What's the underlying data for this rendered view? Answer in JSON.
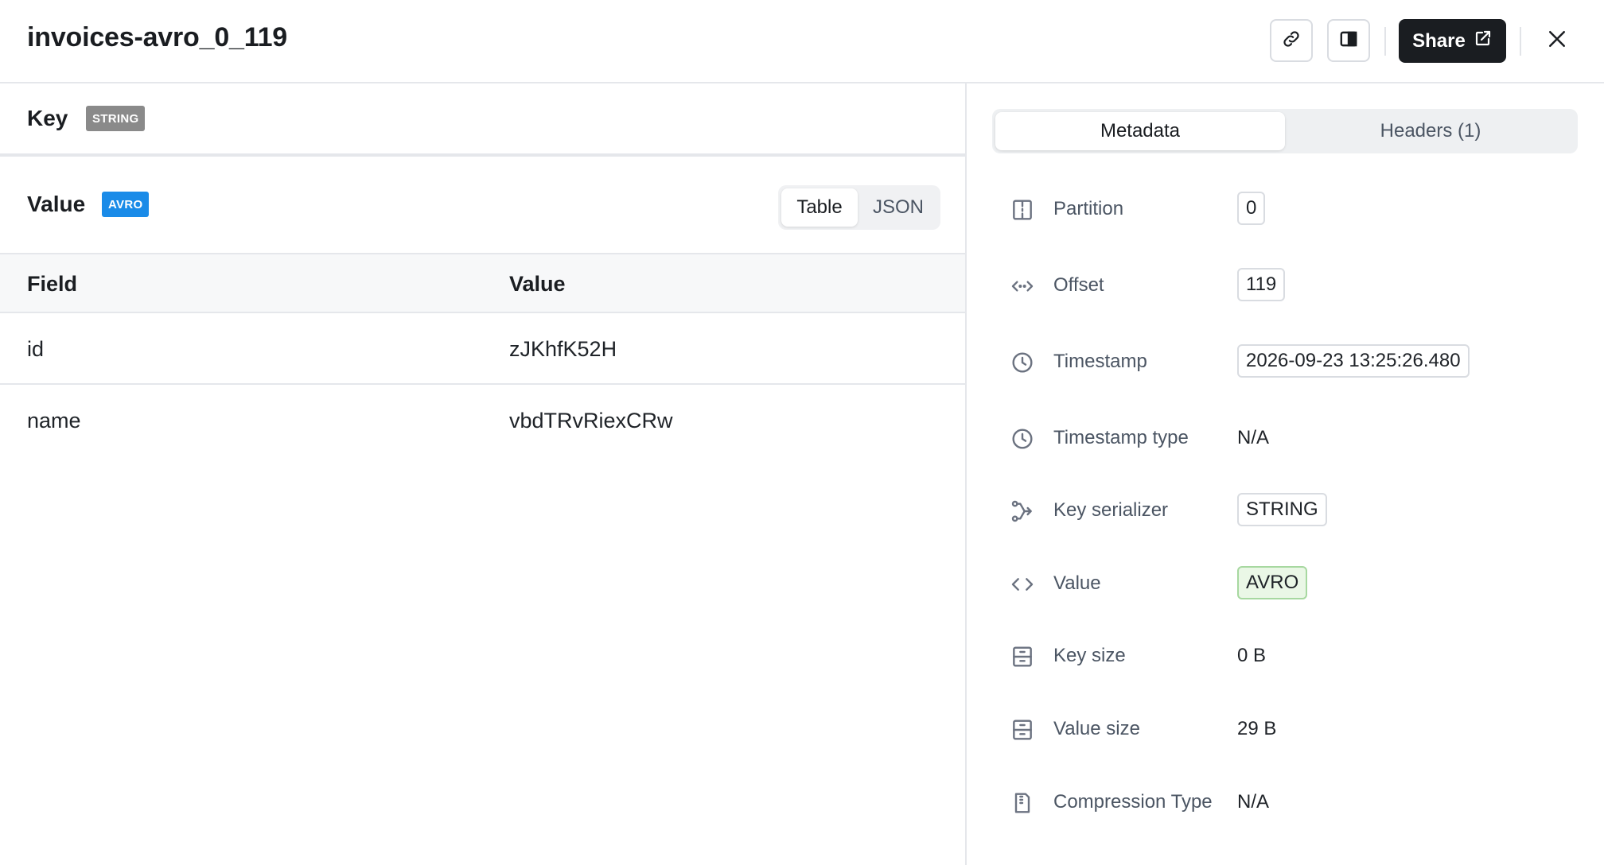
{
  "header": {
    "title": "invoices-avro_0_119",
    "share_label": "Share"
  },
  "key_section": {
    "label": "Key",
    "badge": "STRING",
    "badge_color": "#8a8a8a"
  },
  "value_section": {
    "label": "Value",
    "badge": "AVRO",
    "badge_color": "#1a8be8",
    "view_toggle": {
      "options": [
        "Table",
        "JSON"
      ],
      "selected": "Table"
    }
  },
  "table": {
    "columns": [
      "Field",
      "Value"
    ],
    "rows": [
      {
        "field": "id",
        "value": "zJKhfK52H"
      },
      {
        "field": "name",
        "value": "vbdTRvRiexCRw"
      }
    ]
  },
  "metadata_tabs": {
    "tabs": [
      "Metadata",
      "Headers (1)"
    ],
    "selected": "Metadata"
  },
  "metadata": [
    {
      "icon": "partition-icon",
      "label": "Partition",
      "value": "0",
      "style": "pill"
    },
    {
      "icon": "code-dots-icon",
      "label": "Offset",
      "value": "119",
      "style": "pill"
    },
    {
      "icon": "clock-icon",
      "label": "Timestamp",
      "value": "2026-09-23 13:25:26.480",
      "style": "pill"
    },
    {
      "icon": "clock-icon",
      "label": "Timestamp type",
      "value": "N/A",
      "style": "text"
    },
    {
      "icon": "serializer-icon",
      "label": "Key serializer",
      "value": "STRING",
      "style": "pill"
    },
    {
      "icon": "code-icon",
      "label": "Value",
      "value": "AVRO",
      "style": "pill-green"
    },
    {
      "icon": "drawer-icon",
      "label": "Key size",
      "value": "0 B",
      "style": "text"
    },
    {
      "icon": "drawer-icon",
      "label": "Value size",
      "value": "29 B",
      "style": "text"
    },
    {
      "icon": "file-zip-icon",
      "label": "Compression Type",
      "value": "N/A",
      "style": "text"
    }
  ]
}
